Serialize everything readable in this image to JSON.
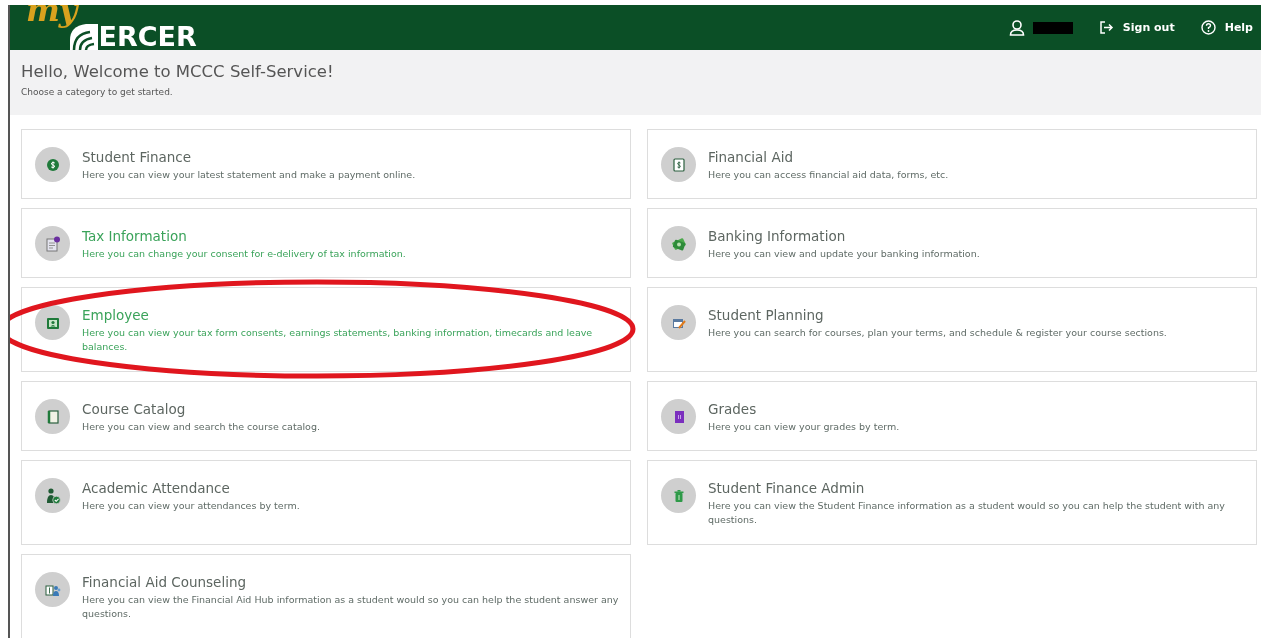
{
  "header": {
    "logo": {
      "prefix": "my",
      "name": "ERCER"
    },
    "user": {
      "redacted": true
    },
    "links": [
      {
        "kind": "signout",
        "label": "Sign out"
      },
      {
        "kind": "help",
        "label": "Help"
      }
    ]
  },
  "welcome": {
    "title": "Hello, Welcome to MCCC Self-Service!",
    "subtitle": "Choose a category to get started."
  },
  "cards": [
    {
      "title": "Student Finance",
      "description": "Here you can view your latest statement and make a payment online.",
      "highlighted": false,
      "circled": false
    },
    {
      "title": "Financial Aid",
      "description": "Here you can access financial aid data, forms, etc.",
      "highlighted": false,
      "circled": false
    },
    {
      "title": "Tax Information",
      "description": "Here you can change your consent for e-delivery of tax information.",
      "highlighted": true,
      "circled": false
    },
    {
      "title": "Banking Information",
      "description": "Here you can view and update your banking information.",
      "highlighted": false,
      "circled": false
    },
    {
      "title": "Employee",
      "description": "Here you can view your tax form consents, earnings statements, banking information, timecards and leave balances.",
      "highlighted": true,
      "circled": true
    },
    {
      "title": "Student Planning",
      "description": "Here you can search for courses, plan your terms, and schedule & register your course sections.",
      "highlighted": false,
      "circled": false
    },
    {
      "title": "Course Catalog",
      "description": "Here you can view and search the course catalog.",
      "highlighted": false,
      "circled": false
    },
    {
      "title": "Grades",
      "description": "Here you can view your grades by term.",
      "highlighted": false,
      "circled": false
    },
    {
      "title": "Academic Attendance",
      "description": "Here you can view your attendances by term.",
      "highlighted": false,
      "circled": false
    },
    {
      "title": "Student Finance Admin",
      "description": "Here you can view the Student Finance information as a student would so you can help the student with any questions.",
      "highlighted": false,
      "circled": false
    },
    {
      "title": "Financial Aid Counseling",
      "description": "Here you can view the Financial Aid Hub information as a student would so you can help the student answer any questions.",
      "highlighted": false,
      "circled": false
    }
  ]
}
